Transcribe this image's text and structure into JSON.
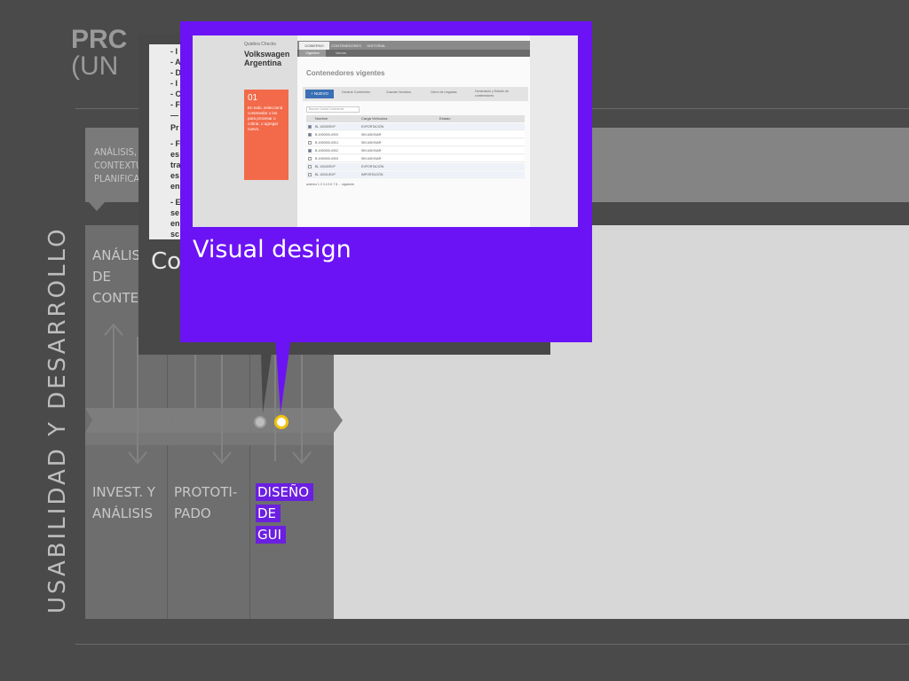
{
  "slide": {
    "title_line1": "PRC",
    "title_line2": "(UN",
    "vertical_label": "USABILIDAD Y DESARROLLO",
    "top_band_label": "ANÁLISIS, CONTEXTU PLANIFICA",
    "top_band_lines": [
      "ANÁLISIS,",
      "CONTEXTU",
      "PLANIFICA"
    ],
    "col1_top_lines": [
      "ANÁLISI",
      "DE",
      "CONTEX"
    ],
    "col1_bottom_lines": [
      "INVEST. Y",
      "ANÁLISIS"
    ],
    "col2_bottom_lines": [
      "PROTOTI-",
      "PADO"
    ],
    "col3_bottom_lines": [
      "DISEÑO",
      "DE",
      "GUI"
    ],
    "back_card_text": [
      "- I",
      "- A",
      "- D",
      "- I",
      "- C",
      "- F",
      "—",
      "Pr",
      "- F",
      "es",
      "tra",
      "es",
      "en",
      "- E",
      "se",
      "en",
      "sc"
    ],
    "back_card_heading": "Co"
  },
  "popup": {
    "title": "Visual design",
    "screenshot": {
      "brand_small": "Quiebra Checks",
      "brand_line1": "Volkswagen",
      "brand_line2": "Argentina",
      "tabs": [
        "GOBIERNO",
        "CONTENEDORES",
        "HISTORIAL"
      ],
      "subtabs": [
        "Vigentes",
        "Vacíos"
      ],
      "heading": "Contenedores vigentes",
      "toolbar": [
        "+ NUEVO",
        "Generar Contenedor",
        "Guardar Vencidos",
        "Cierre de Llegadas",
        "Generación y Edición de contenedores"
      ],
      "search_placeholder": "Buscar Carta/Contenedor",
      "columns": [
        "Nombre",
        "Carga Vehículos",
        "Estado"
      ],
      "rows": [
        {
          "name": "BL 10030/EXP",
          "col2": "EXPORTACIÓN",
          "checked": true
        },
        {
          "name": "B-1000000-0000",
          "col2": "SIN ASIGNAR",
          "checked": true
        },
        {
          "name": "B-1000000-0001",
          "col2": "SIN ASIGNAR",
          "checked": false
        },
        {
          "name": "B-1000000-0002",
          "col2": "SIN ASIGNAR",
          "checked": true
        },
        {
          "name": "B-1000000-0003",
          "col2": "SIN ASIGNAR",
          "checked": false
        },
        {
          "name": "BL 10040/EXP",
          "col2": "EXPORTACIÓN",
          "checked": false
        },
        {
          "name": "BL 10041/EXP",
          "col2": "IMPORTACIÓN",
          "checked": false
        }
      ],
      "pagination": "anterior 1 2 3 4 5 6 7 8 ... siguiente",
      "callout_number": "01",
      "callout_text": "En todo, seleccioná contenedor o los para procesar o cobrar, o agregar nuevo.",
      "colors": {
        "callout": "#f26a4a",
        "header": "#e2e2e2",
        "accent_blue": "#3a6fb5"
      }
    }
  },
  "colors": {
    "background": "#4a4a4a",
    "popup": "#6b13f5",
    "highlight": "#6b1fe0",
    "dot_gray": "#c0c0c0",
    "dot_yellow": "#f2c20c"
  }
}
